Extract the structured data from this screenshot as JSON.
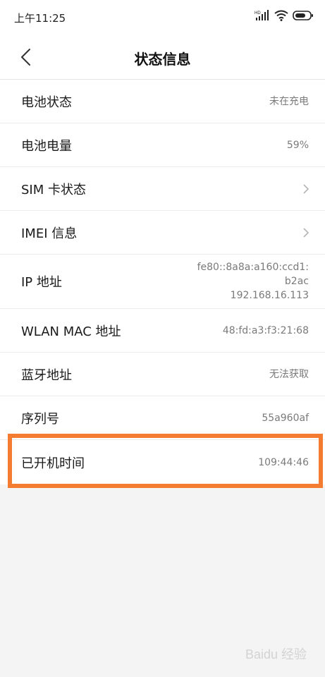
{
  "status_bar": {
    "time": "上午11:25",
    "network_label": "HD"
  },
  "header": {
    "title": "状态信息"
  },
  "rows": [
    {
      "label": "电池状态",
      "value": "未在充电"
    },
    {
      "label": "电池电量",
      "value": "59%"
    },
    {
      "label": "SIM 卡状态"
    },
    {
      "label": "IMEI 信息"
    },
    {
      "label": "IP 地址",
      "value_lines": [
        "fe80::8a8a:a160:ccd1:",
        "b2ac",
        "192.168.16.113"
      ]
    },
    {
      "label": "WLAN MAC 地址",
      "value": "48:fd:a3:f3:21:68"
    },
    {
      "label": "蓝牙地址",
      "value": "无法获取"
    },
    {
      "label": "序列号",
      "value": "55a960af"
    },
    {
      "label": "已开机时间",
      "value": "109:44:46"
    }
  ],
  "watermark": "Baidu 经验",
  "colors": {
    "highlight": "#f47c30",
    "background": "#f4f4f4"
  }
}
